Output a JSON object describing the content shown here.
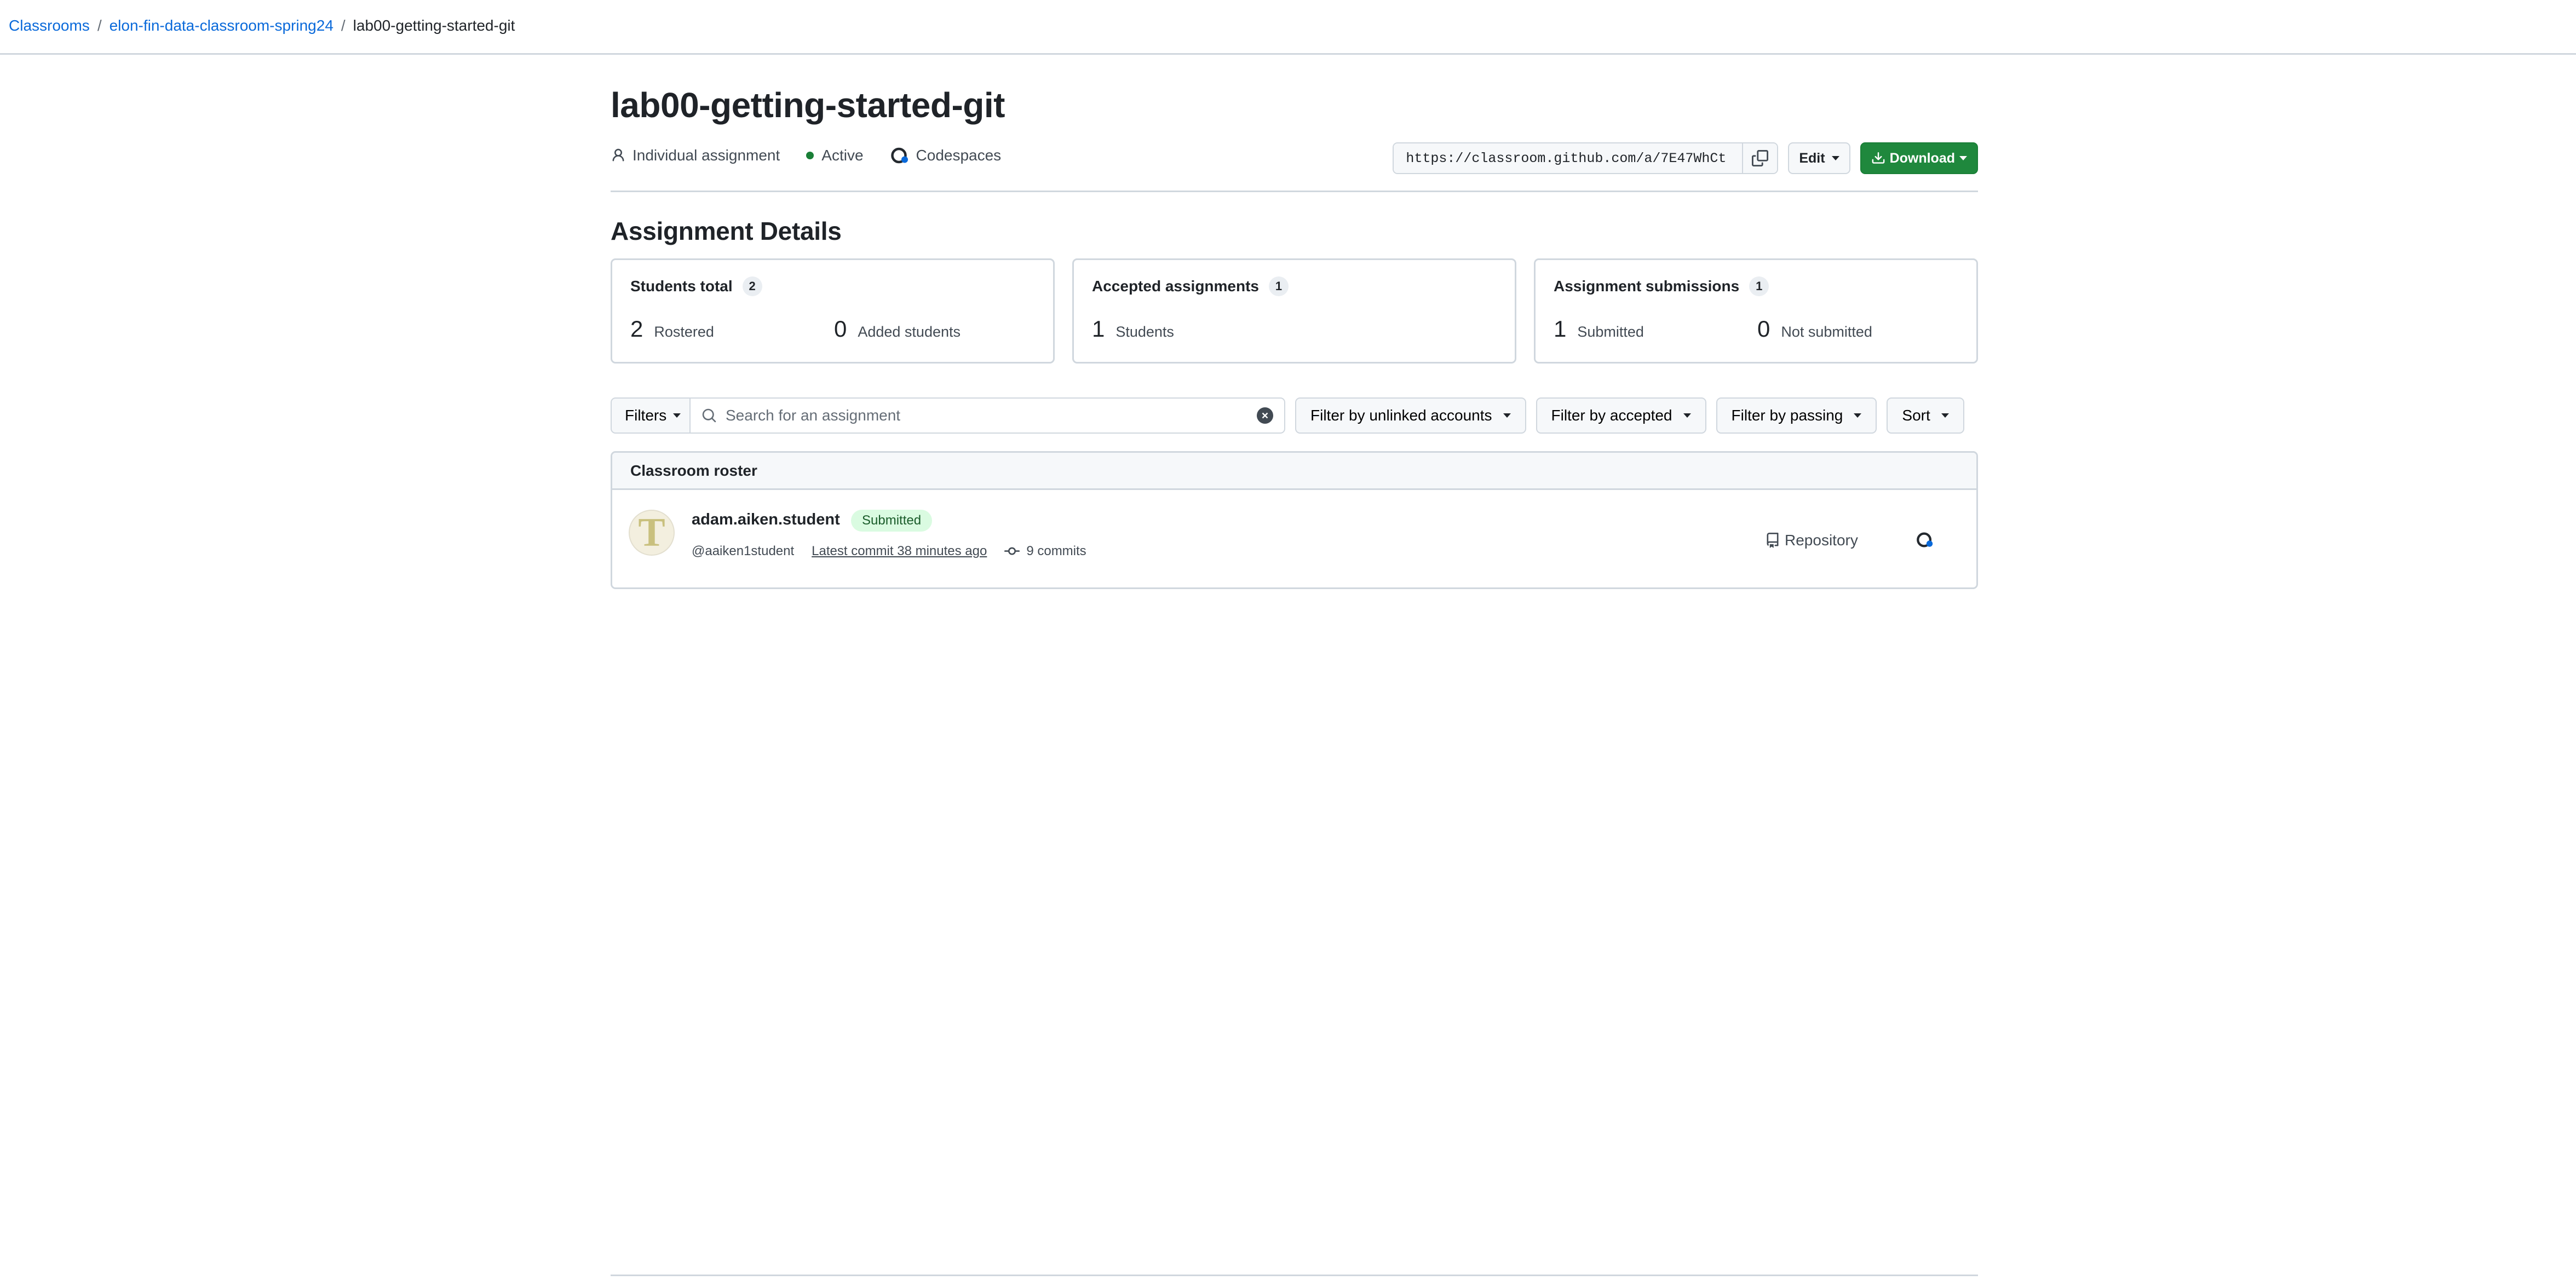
{
  "breadcrumb": {
    "items": [
      "Classrooms",
      "elon-fin-data-classroom-spring24"
    ],
    "current": "lab00-getting-started-git",
    "separator": "/"
  },
  "assignment": {
    "title": "lab00-getting-started-git",
    "type_label": "Individual assignment",
    "status_label": "Active",
    "status_color": "#1a7f37",
    "environment_label": "Codespaces",
    "invite_url": "https://classroom.github.com/a/7E47WhCt",
    "edit_label": "Edit",
    "download_label": "Download"
  },
  "details": {
    "heading": "Assignment Details",
    "cards": [
      {
        "title": "Students total",
        "count": "2",
        "stats": [
          {
            "value": "2",
            "label": "Rostered"
          },
          {
            "value": "0",
            "label": "Added students"
          }
        ]
      },
      {
        "title": "Accepted assignments",
        "count": "1",
        "stats": [
          {
            "value": "1",
            "label": "Students"
          }
        ]
      },
      {
        "title": "Assignment submissions",
        "count": "1",
        "stats": [
          {
            "value": "1",
            "label": "Submitted"
          },
          {
            "value": "0",
            "label": "Not submitted"
          }
        ]
      }
    ]
  },
  "filters": {
    "filters_label": "Filters",
    "search_placeholder": "Search for an assignment",
    "unlinked_label": "Filter by unlinked accounts",
    "accepted_label": "Filter by accepted",
    "passing_label": "Filter by passing",
    "sort_label": "Sort"
  },
  "roster": {
    "heading": "Classroom roster",
    "students": [
      {
        "avatar_initial": "T",
        "name": "adam.aiken.student",
        "status_badge": "Submitted",
        "handle": "@aaiken1student",
        "latest_commit": "Latest commit 38 minutes ago",
        "commits": "9 commits",
        "repo_label": "Repository"
      }
    ]
  },
  "colors": {
    "accent": "#0969da",
    "primary_button": "#1f883d",
    "badge_bg": "#dafbe1",
    "border": "#d0d7de"
  }
}
